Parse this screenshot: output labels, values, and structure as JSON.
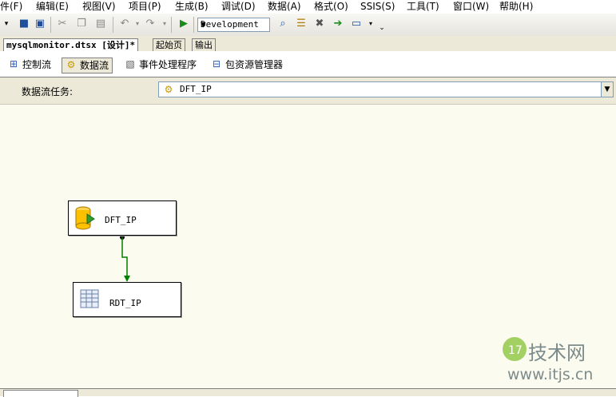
{
  "menubar": {
    "items": [
      "件(F)",
      "编辑(E)",
      "视图(V)",
      "项目(P)",
      "生成(B)",
      "调试(D)",
      "数据(A)",
      "格式(O)",
      "SSIS(S)",
      "工具(T)",
      "窗口(W)",
      "帮助(H)"
    ]
  },
  "toolbar": {
    "configuration": "Development",
    "icons": [
      "dropdown-icon",
      "save-icon",
      "save-all-icon",
      "cut-icon",
      "copy-icon",
      "paste-icon",
      "undo-icon",
      "redo-icon",
      "start-icon",
      "solution-explorer-icon",
      "properties-icon",
      "toolbox-icon",
      "designer-icon",
      "command-window-icon"
    ]
  },
  "doc_tabs": {
    "active": "mysqlmonitor.dtsx [设计]*",
    "start": "起始页",
    "output": "输出"
  },
  "designer_tabs": {
    "control_flow": "控制流",
    "data_flow": "数据流",
    "event_handlers": "事件处理程序",
    "package_explorer": "包资源管理器"
  },
  "task_selector": {
    "label": "数据流任务:",
    "value": "DFT_IP"
  },
  "components": {
    "source": "DFT_IP",
    "destination": "RDT_IP"
  },
  "watermark": {
    "site": "技术网",
    "url": "www.itjs.cn"
  },
  "colors": {
    "canvas": "#fcfbef",
    "path": "#008000"
  }
}
